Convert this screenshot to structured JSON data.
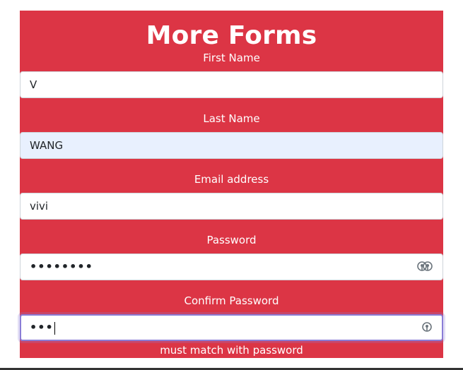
{
  "theme": {
    "accent": "#dc3545",
    "focus_ring": "#8a7dd6",
    "autofill_bg": "#e8f0fe"
  },
  "form": {
    "title": "More Forms",
    "fields": [
      {
        "label": "First Name",
        "value": "V"
      },
      {
        "label": "Last Name",
        "value": "WANG"
      },
      {
        "label": "Email address",
        "value": "vivi"
      },
      {
        "label": "Password",
        "value": "••••••••",
        "icon": "password-manager-icon"
      },
      {
        "label": "Confirm Password",
        "value": "•••",
        "icon": "password-manager-icon"
      }
    ],
    "confirm_helper": "must match with password"
  }
}
